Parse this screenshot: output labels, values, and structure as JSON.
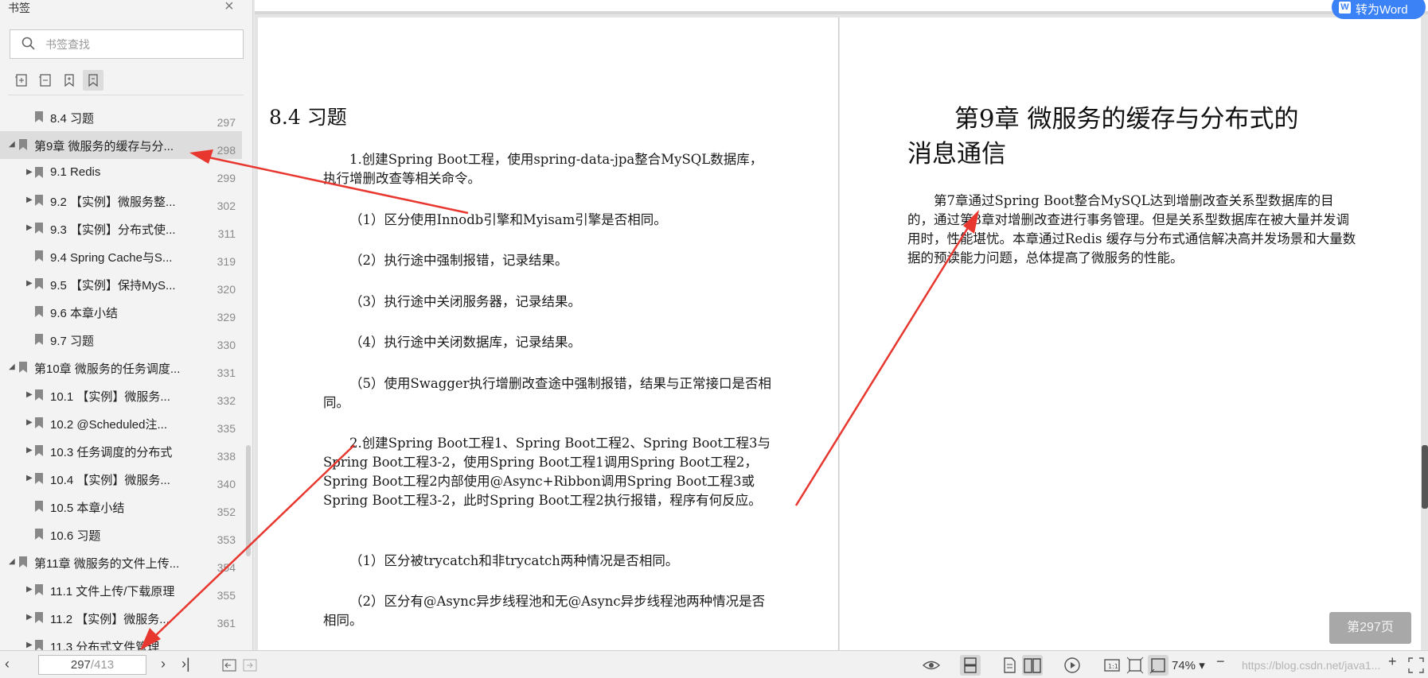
{
  "sidebar": {
    "title": "书签",
    "search_placeholder": "书签查找",
    "items": [
      {
        "label": "8.4 习题",
        "page": "297",
        "level": 1,
        "expand": false
      },
      {
        "label": "第9章 微服务的缓存与分...",
        "page": "298",
        "level": 0,
        "expand": true,
        "selected": true
      },
      {
        "label": "9.1 Redis",
        "page": "299",
        "level": 1,
        "expand": true
      },
      {
        "label": "9.2 【实例】微服务整...",
        "page": "302",
        "level": 1,
        "expand": true
      },
      {
        "label": "9.3 【实例】分布式使...",
        "page": "311",
        "level": 1,
        "expand": true
      },
      {
        "label": "9.4 Spring Cache与S...",
        "page": "319",
        "level": 1,
        "expand": false
      },
      {
        "label": "9.5 【实例】保持MyS...",
        "page": "320",
        "level": 1,
        "expand": true
      },
      {
        "label": "9.6 本章小结",
        "page": "329",
        "level": 1,
        "expand": false
      },
      {
        "label": "9.7 习题",
        "page": "330",
        "level": 1,
        "expand": false
      },
      {
        "label": "第10章 微服务的任务调度...",
        "page": "331",
        "level": 0,
        "expand": true
      },
      {
        "label": "10.1 【实例】微服务...",
        "page": "332",
        "level": 1,
        "expand": true
      },
      {
        "label": "10.2 @Scheduled注...",
        "page": "335",
        "level": 1,
        "expand": true
      },
      {
        "label": "10.3 任务调度的分布式",
        "page": "338",
        "level": 1,
        "expand": true
      },
      {
        "label": "10.4 【实例】微服务...",
        "page": "340",
        "level": 1,
        "expand": true
      },
      {
        "label": "10.5 本章小结",
        "page": "352",
        "level": 1,
        "expand": false
      },
      {
        "label": "10.6 习题",
        "page": "353",
        "level": 1,
        "expand": false
      },
      {
        "label": "第11章 微服务的文件上传...",
        "page": "354",
        "level": 0,
        "expand": true
      },
      {
        "label": "11.1 文件上传/下载原理",
        "page": "355",
        "level": 1,
        "expand": true
      },
      {
        "label": "11.2 【实例】微服务...",
        "page": "361",
        "level": 1,
        "expand": true
      },
      {
        "label": "11.3 分布式文件管理",
        "page": "",
        "level": 1,
        "expand": true
      }
    ]
  },
  "left_page": {
    "heading": "8.4 习题",
    "paragraphs": [
      "1.创建Spring Boot工程，使用spring-data-jpa整合MySQL数据库，执行增删改查等相关命令。",
      "（1）区分使用Innodb引擎和Myisam引擎是否相同。",
      "（2）执行途中强制报错，记录结果。",
      "（3）执行途中关闭服务器，记录结果。",
      "（4）执行途中关闭数据库，记录结果。",
      "（5）使用Swagger执行增删改查途中强制报错，结果与正常接口是否相同。",
      "2.创建Spring Boot工程1、Spring Boot工程2、Spring Boot工程3与Spring Boot工程3-2，使用Spring Boot工程1调用Spring Boot工程2，Spring Boot工程2内部使用@Async+Ribbon调用Spring Boot工程3或Spring Boot工程3-2，此时Spring Boot工程2执行报错，程序有何反应。",
      "（1）区分被trycatch和非trycatch两种情况是否相同。",
      "（2）区分有@Async异步线程池和无@Async异步线程池两种情况是否相同。"
    ]
  },
  "right_page": {
    "heading_line1": "第9章  微服务的缓存与分布式的",
    "heading_line2": "消息通信",
    "body": "第7章通过Spring Boot整合MySQL达到增删改查关系型数据库的目的，通过第8章对增删改查进行事务管理。但是关系型数据库在被大量并发调用时，性能堪忧。本章通过Redis 缓存与分布式通信解决高并发场景和大量数据的预读能力问题，总体提高了微服务的性能。"
  },
  "overlay": {
    "convert_word": "转为Word",
    "page_indicator": "第297页"
  },
  "bottom_bar": {
    "current_page": "297",
    "total_pages": "/413",
    "zoom": "74%",
    "watermark": "https://blog.csdn.net/java1..."
  },
  "colors": {
    "accent": "#3b82f6",
    "arrow": "#e8372f",
    "selected_row": "#dddddd"
  }
}
